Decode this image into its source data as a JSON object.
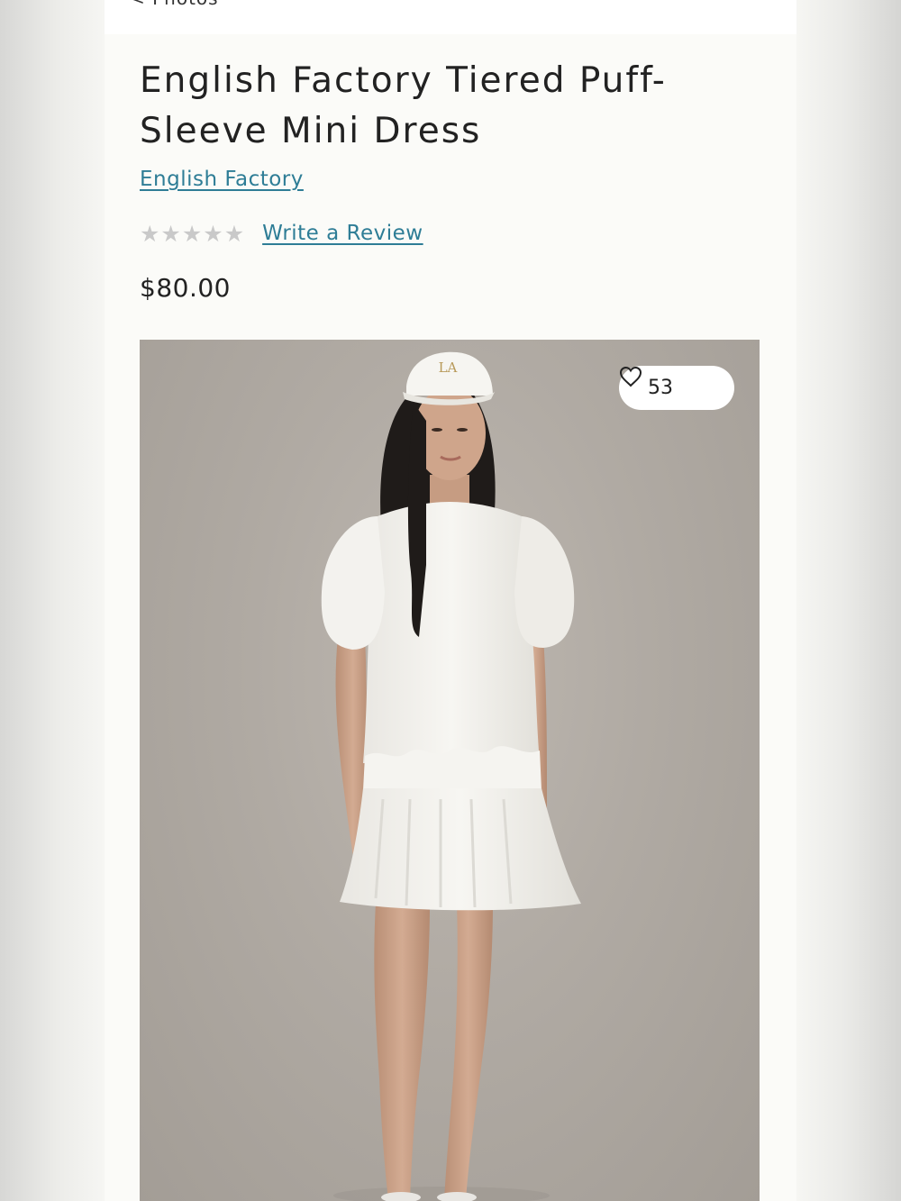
{
  "nav": {
    "back_label": "< Photos"
  },
  "product": {
    "title": "English Factory Tiered Puff-Sleeve Mini Dress",
    "brand": "English Factory",
    "rating": 0,
    "rating_max": 5,
    "review_link": "Write a Review",
    "price": "$80.00"
  },
  "image": {
    "favorites_count": "53",
    "cap_logo": "LA"
  },
  "colors": {
    "link": "#2e7d96",
    "star_empty": "#c9c9c9",
    "text": "#222222",
    "page_bg": "#fbfbf8"
  },
  "icons": {
    "rating_star": "star-icon",
    "favorite": "heart-icon"
  }
}
